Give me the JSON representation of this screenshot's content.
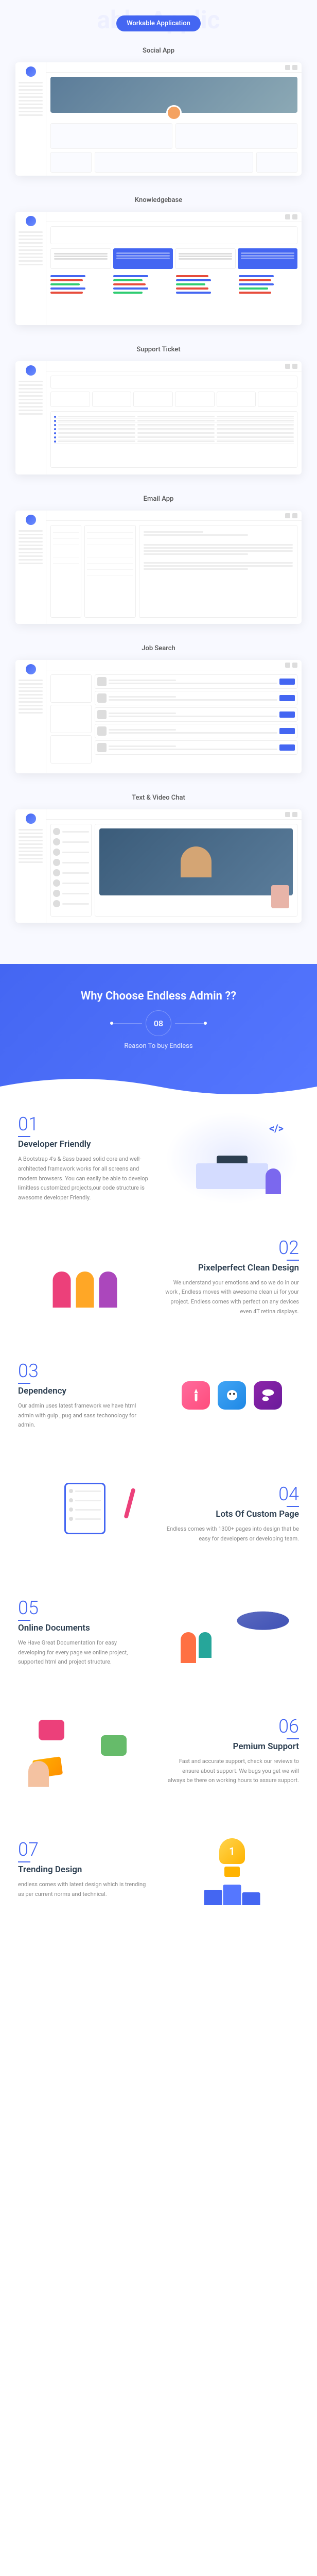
{
  "header": {
    "badge": "Workable Application",
    "ghost": "able Applic"
  },
  "apps": [
    {
      "title": "Social App",
      "type": "social"
    },
    {
      "title": "Knowledgebase",
      "type": "kb"
    },
    {
      "title": "Support Ticket",
      "type": "ticket"
    },
    {
      "title": "Email App",
      "type": "email"
    },
    {
      "title": "Job Search",
      "type": "job"
    },
    {
      "title": "Text & Video Chat",
      "type": "chat"
    }
  ],
  "why": {
    "title": "Why Choose Endless Admin ??",
    "count": "08",
    "subtitle": "Reason To buy Endless"
  },
  "features": [
    {
      "num": "01",
      "title": "Developer Friendly",
      "desc": "A Bootstrap 4's & Sass based solid core and well-architected framework works for all screens and modern browsers. You can easily be able to develop limitless customized projects,our code structure is awesome developer Friendly."
    },
    {
      "num": "02",
      "title": "Pixelperfect Clean Design",
      "desc": "We understand your emotions and so we do in our work , Endless moves with awesome clean ui for your project. Endless comes with perfect on any devices even 4T retina displays."
    },
    {
      "num": "03",
      "title": "Dependency",
      "desc": "Our admin uses latest framework we have html admin with gulp , pug and sass techonology for admin."
    },
    {
      "num": "04",
      "title": "Lots Of Custom Page",
      "desc": "Endless comes with 1300+ pages into design that be easy for developers or developing team."
    },
    {
      "num": "05",
      "title": "Online Documents",
      "desc": "We Have Great Documentation for easy developing.for every page we online project, supported html and project structure."
    },
    {
      "num": "06",
      "title": "Pemium Support",
      "desc": "Fast and accurate support, check our reviews to ensure about support. We bugs you get we will always be there on working hours to assure support."
    },
    {
      "num": "07",
      "title": "Trending Design",
      "desc": "endless comes with latest design which is trending as per current norms and technical."
    }
  ]
}
